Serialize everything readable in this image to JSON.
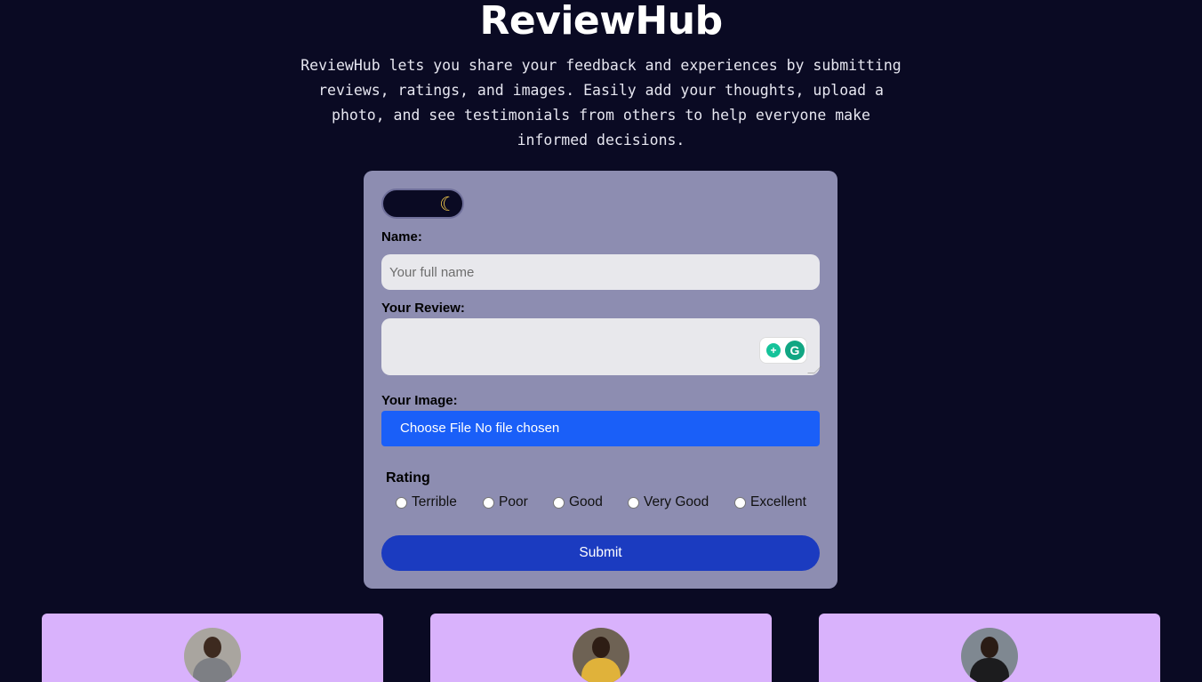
{
  "header": {
    "title": "ReviewHub",
    "description": "ReviewHub lets you share your feedback and experiences by submitting reviews, ratings, and images. Easily add your thoughts, upload a photo, and see testimonials from others to help everyone make informed decisions."
  },
  "form": {
    "theme_toggle_icon": "moon-icon",
    "name_label": "Name:",
    "name_placeholder": "Your full name",
    "name_value": "",
    "review_label": "Your Review:",
    "review_value": "",
    "image_label": "Your Image:",
    "file_button": "Choose File",
    "file_status": "No file chosen",
    "rating_label": "Rating",
    "rating_options": [
      "Terrible",
      "Poor",
      "Good",
      "Very Good",
      "Excellent"
    ],
    "submit_label": "Submit"
  },
  "testimonials": [
    {
      "avatar": "man-in-suit-avatar"
    },
    {
      "avatar": "woman-in-yellow-avatar"
    },
    {
      "avatar": "man-in-black-avatar"
    }
  ],
  "colors": {
    "page_bg": "#0a0a23",
    "card_bg": "#8d8db1",
    "file_button_bg": "#1a5ff8",
    "submit_bg": "#1b3bc0",
    "testimonial_bg": "#d9b2fc"
  }
}
